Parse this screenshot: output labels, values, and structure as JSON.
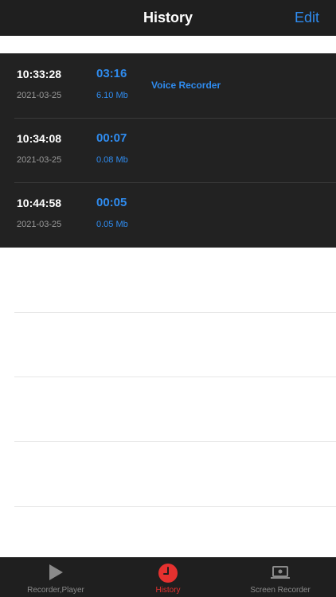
{
  "navbar": {
    "title": "History",
    "edit_label": "Edit"
  },
  "recordings": [
    {
      "time": "10:33:28",
      "date": "2021-03-25",
      "duration": "03:16",
      "size": "6.10 Mb",
      "source": "Voice Recorder"
    },
    {
      "time": "10:34:08",
      "date": "2021-03-25",
      "duration": "00:07",
      "size": "0.08 Mb",
      "source": ""
    },
    {
      "time": "10:44:58",
      "date": "2021-03-25",
      "duration": "00:05",
      "size": "0.05 Mb",
      "source": ""
    }
  ],
  "tabbar": {
    "tabs": [
      {
        "label": "Recorder,Player",
        "icon": "play-icon",
        "active": false
      },
      {
        "label": "History",
        "icon": "clock-icon",
        "active": true
      },
      {
        "label": "Screen Recorder",
        "icon": "screen-recorder-icon",
        "active": false
      }
    ]
  },
  "colors": {
    "accent": "#2f8cf0",
    "active_tab": "#e5312f",
    "bar_background": "#1f1f1f",
    "list_background": "#222222"
  }
}
